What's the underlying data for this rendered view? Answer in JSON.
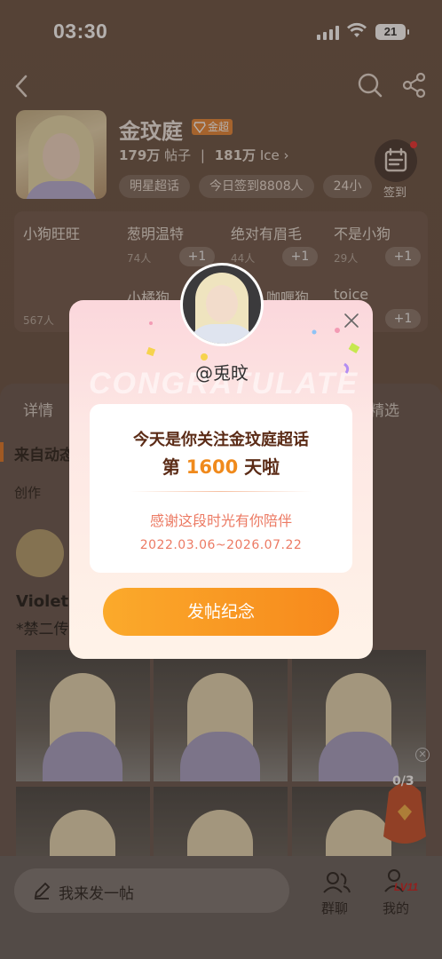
{
  "status": {
    "time": "03:30",
    "battery": "21"
  },
  "topic": {
    "name": "金玟庭",
    "badge": "金超",
    "posts_count": "179万",
    "posts_label": "帖子",
    "ice_count": "181万",
    "ice_label": "Ice"
  },
  "chips": [
    "明星超话",
    "今日签到8808人",
    "24小"
  ],
  "signin_label": "签到",
  "ranks": [
    {
      "name": "小狗旺旺",
      "count": "567人"
    },
    {
      "name": "葱明温特",
      "count": "74人",
      "action": "+1"
    },
    {
      "name": "绝对有眉毛",
      "count": "44人",
      "action": "+1"
    },
    {
      "name": "不是小狗",
      "count": "29人",
      "action": "+1"
    },
    {
      "name": "小橘狗",
      "count": ""
    },
    {
      "name": "咖喱狗",
      "count": ""
    },
    {
      "name": "toice",
      "count": "",
      "action": "+1"
    }
  ],
  "sheet": {
    "tab_detail": "详情",
    "tab_selected": "精选",
    "auto_label": "来自动态",
    "creator_label": "创作"
  },
  "post": {
    "title": "Violeta",
    "subtitle": "*禁二传"
  },
  "lottery": {
    "count": "0/3"
  },
  "bottombar": {
    "compose_placeholder": "我来发一帖",
    "group_chat": "群聊",
    "mine": "我的",
    "level": "LV11"
  },
  "modal": {
    "watermark": "CONGRATULATE",
    "username": "@兎旼",
    "line1": "今天是你关注金玟庭超话",
    "line2_prefix": "第 ",
    "days": "1600",
    "line2_suffix": " 天啦",
    "line3": "感谢这段时光有你陪伴",
    "date_range": "2022.03.06~2026.07.22",
    "button": "发帖纪念"
  },
  "colors": {
    "accent": "#f7891c",
    "text_dark": "#5b2b16",
    "pink_text": "#ec7a63"
  }
}
